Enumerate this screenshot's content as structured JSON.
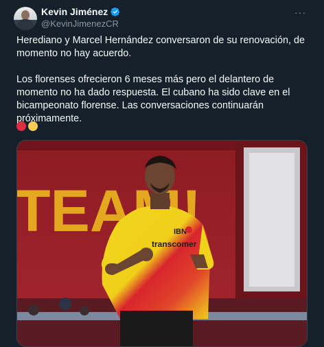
{
  "author": {
    "name": "Kevin Jiménez",
    "handle": "@KevinJimenezCR",
    "avatar_icon": "avatar-icon",
    "verified_icon": "verified-badge-icon",
    "verified_color": "#1d9bf0"
  },
  "menu": {
    "more_label": "···"
  },
  "tweet": {
    "paragraph1": "Herediano y Marcel Hernández conversaron de su renovación, de momento no hay acuerdo.",
    "paragraph2": "Los florenses ofrecieron 6 meses más pero el delantero de momento no ha dado respuesta. El cubano ha sido clave en el bicampeonato florense. Las conversaciones continuarán próximamente."
  },
  "emojis": [
    {
      "icon": "red-circle-icon",
      "color": "#dd2e44"
    },
    {
      "icon": "yellow-circle-icon",
      "color": "#fdcb58"
    }
  ],
  "photo": {
    "banner_text": "TEAM!",
    "jersey_sponsor_1": "IBN",
    "jersey_sponsor_2": "transcomer",
    "colors": {
      "banner": "#a8202a",
      "banner_text": "#e4a820",
      "jersey_yellow": "#f1d21c",
      "jersey_red": "#d8252c"
    }
  }
}
